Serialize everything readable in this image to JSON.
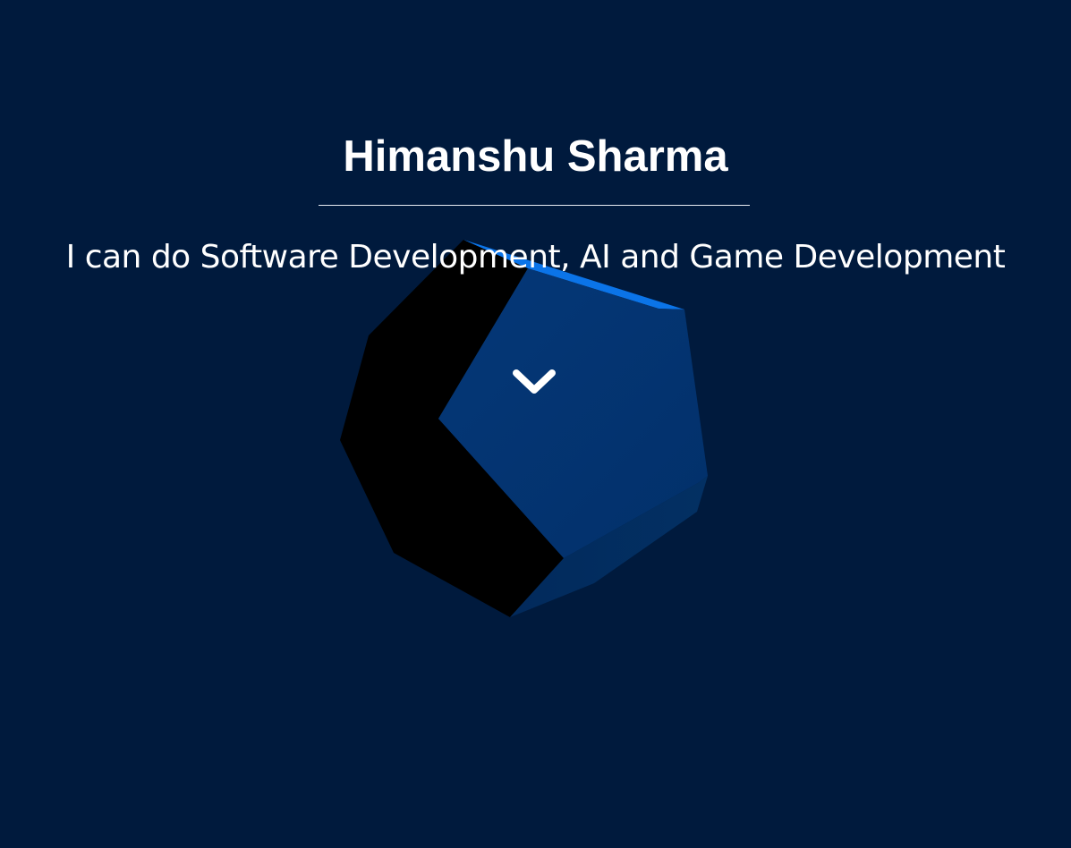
{
  "hero": {
    "name": "Himanshu Sharma",
    "tagline": "I can do Software Development, AI and Game Development",
    "scroll_icon": "chevron-down-icon"
  },
  "colors": {
    "background": "#001a3d",
    "shape_front": "#03346e",
    "shape_dark": "#000000",
    "shape_edge_highlight": "#0b74e8",
    "text": "#ffffff"
  }
}
